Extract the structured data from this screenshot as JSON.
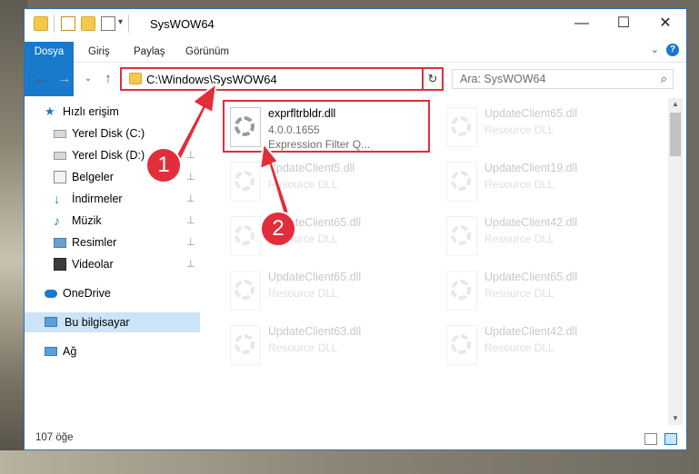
{
  "window": {
    "title": "SysWOW64",
    "minimize": "—",
    "maximize": "☐",
    "close": "✕"
  },
  "ribbon": {
    "tabs": [
      "Dosya",
      "Giriş",
      "Paylaş",
      "Görünüm"
    ],
    "help": "?",
    "expand": "⌄"
  },
  "nav": {
    "back": "←",
    "forward": "→",
    "recent": "⌄",
    "up": "↑",
    "address": "C:\\Windows\\SysWOW64",
    "address_dropdown": "⌄",
    "refresh": "↻",
    "search_placeholder": "Ara: SysWOW64",
    "search_icon": "⌕"
  },
  "sidebar": {
    "items": [
      {
        "label": "Hızlı erişim",
        "icon": "star-icon",
        "pinned": false
      },
      {
        "label": "Yerel Disk (C:)",
        "icon": "drive-icon",
        "pinned": true
      },
      {
        "label": "Yerel Disk (D:)",
        "icon": "drive-icon",
        "pinned": true
      },
      {
        "label": "Belgeler",
        "icon": "document-icon",
        "pinned": true
      },
      {
        "label": "İndirmeler",
        "icon": "download-icon",
        "pinned": true
      },
      {
        "label": "Müzik",
        "icon": "music-icon",
        "pinned": true
      },
      {
        "label": "Resimler",
        "icon": "pictures-icon",
        "pinned": true
      },
      {
        "label": "Videolar",
        "icon": "video-icon",
        "pinned": true
      },
      {
        "label": "OneDrive",
        "icon": "cloud-icon",
        "pinned": false
      },
      {
        "label": "Bu bilgisayar",
        "icon": "computer-icon",
        "pinned": false,
        "selected": true
      },
      {
        "label": "Ağ",
        "icon": "network-icon",
        "pinned": false
      }
    ],
    "pin_glyph": "📌"
  },
  "files": [
    {
      "name": "exprfltrbldr.dll",
      "version": "4.0.0.1655",
      "desc": "Expression Filter Q...",
      "highlighted": true
    },
    {
      "name": "UpdateClient65.dll",
      "desc": "Resource DLL"
    },
    {
      "name": "UpdateClient5.dll",
      "desc": "Resource DLL"
    },
    {
      "name": "UpdateClient19.dll",
      "desc": "Resource DLL"
    },
    {
      "name": "UpdateClient65.dll",
      "desc": "Resource DLL"
    },
    {
      "name": "UpdateClient42.dll",
      "desc": "Resource DLL"
    },
    {
      "name": "UpdateClient65.dll",
      "desc": "Resource DLL"
    },
    {
      "name": "UpdateClient65.dll",
      "desc": "Resource DLL"
    },
    {
      "name": "UpdateClient63.dll",
      "desc": "Resource DLL"
    },
    {
      "name": "UpdateClient42.dll",
      "desc": "Resource DLL"
    }
  ],
  "status": {
    "count": "107 öğe"
  },
  "markers": [
    "1",
    "2"
  ],
  "colors": {
    "accent": "#1979ca",
    "highlight": "#e22d3a"
  }
}
